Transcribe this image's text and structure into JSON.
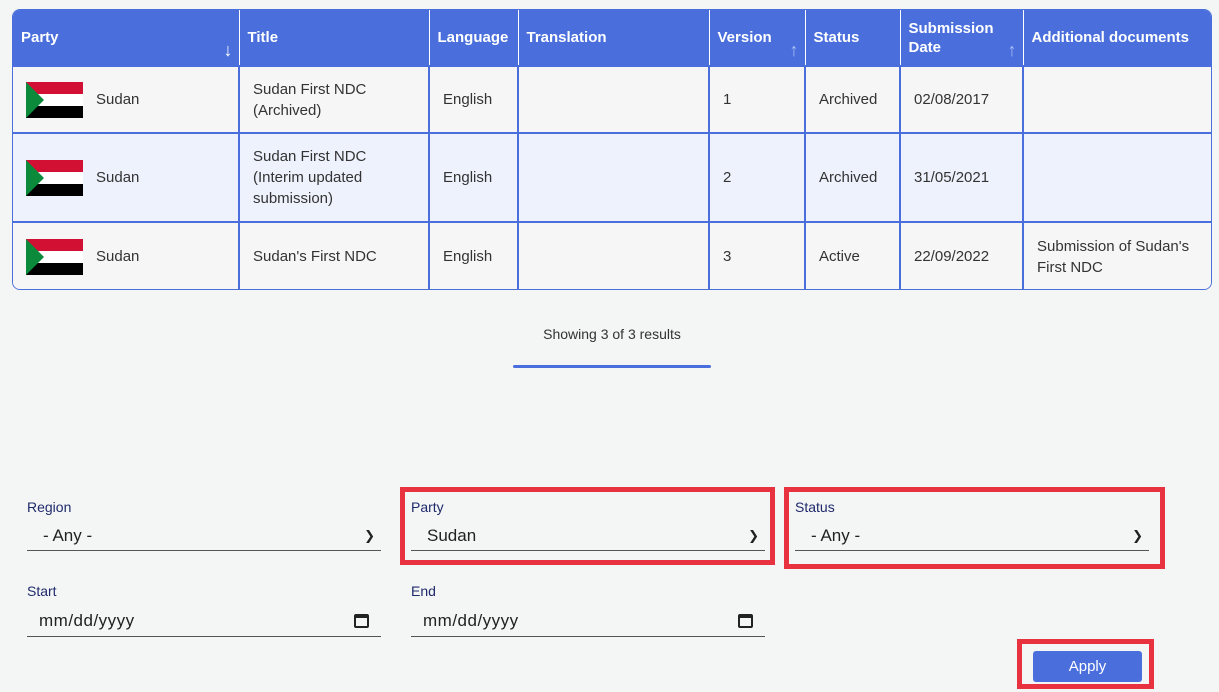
{
  "table": {
    "headers": {
      "party": "Party",
      "title": "Title",
      "language": "Language",
      "translation": "Translation",
      "version": "Version",
      "status": "Status",
      "submission_date": "Submission Date",
      "additional_documents": "Additional documents"
    },
    "rows": [
      {
        "party": "Sudan",
        "title": "Sudan First NDC (Archived)",
        "language": "English",
        "translation": "",
        "version": "1",
        "status": "Archived",
        "submission_date": "02/08/2017",
        "additional_documents": ""
      },
      {
        "party": "Sudan",
        "title": "Sudan First NDC (Interim updated submission)",
        "language": "English",
        "translation": "",
        "version": "2",
        "status": "Archived",
        "submission_date": "31/05/2021",
        "additional_documents": ""
      },
      {
        "party": "Sudan",
        "title": "Sudan's First NDC",
        "language": "English",
        "translation": "",
        "version": "3",
        "status": "Active",
        "submission_date": "22/09/2022",
        "additional_documents": "Submission of Sudan's First NDC"
      }
    ]
  },
  "results_text": "Showing 3 of 3 results",
  "filters": {
    "region": {
      "label": "Region",
      "value": "- Any -"
    },
    "party": {
      "label": "Party",
      "value": "Sudan"
    },
    "status": {
      "label": "Status",
      "value": "- Any -"
    },
    "start": {
      "label": "Start",
      "value": "mm/dd/yyyy"
    },
    "end": {
      "label": "End",
      "value": "mm/dd/yyyy"
    },
    "apply_label": "Apply"
  },
  "colors": {
    "accent": "#4a6fdc",
    "highlight": "#e8323f",
    "flag_red": "#d21034",
    "flag_white": "#ffffff",
    "flag_black": "#000000",
    "flag_green": "#0b8a3c"
  }
}
